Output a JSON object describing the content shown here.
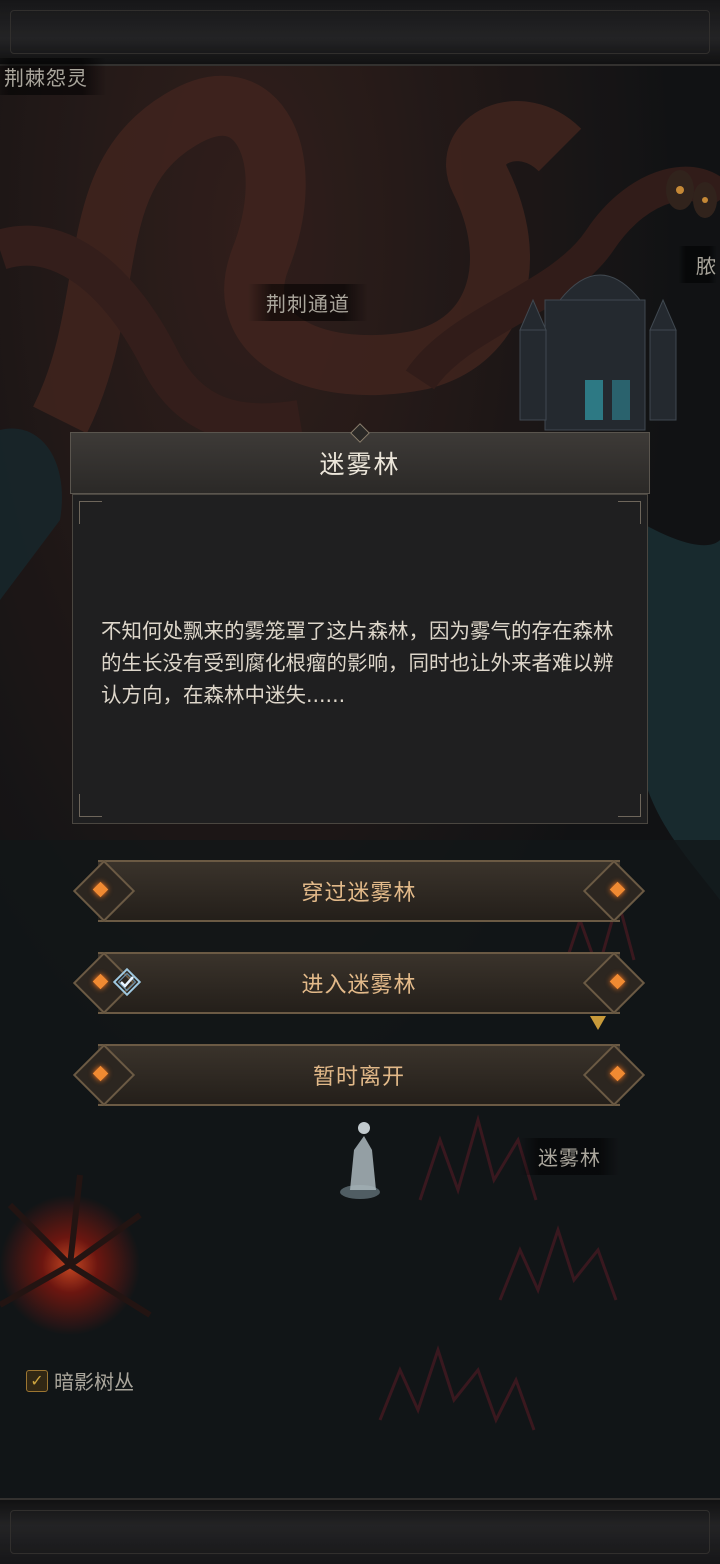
{
  "map": {
    "labels": {
      "top_left_cut": "荆棘怨灵",
      "thorn_path": "荆刺通道",
      "right_cut": "脓",
      "mist_forest": "迷雾林",
      "shadow_bush": "暗影树丛"
    },
    "shadow_bush_checked": true
  },
  "dialog": {
    "title": "迷雾林",
    "description": "不知何处飘来的雾笼罩了这片森林，因为雾气的存在森林的生长没有受到腐化根瘤的影响，同时也让外来者难以辨认方向，在森林中迷失......"
  },
  "options": [
    {
      "label": "穿过迷雾林",
      "selected": false
    },
    {
      "label": "进入迷雾林",
      "selected": true
    },
    {
      "label": "暂时离开",
      "selected": false
    }
  ],
  "colors": {
    "accent_orange": "#f08a32",
    "option_text": "#e2b989",
    "panel_bg": "#1f1f20"
  }
}
